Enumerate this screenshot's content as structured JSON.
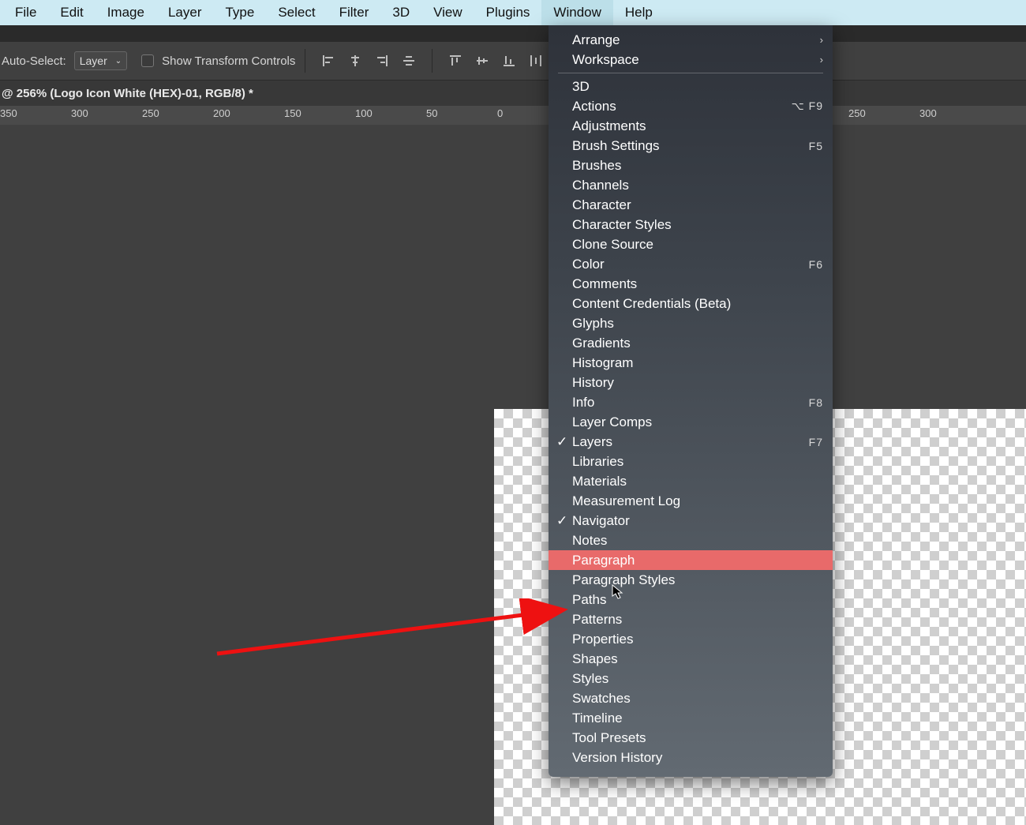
{
  "menubar": {
    "items": [
      "File",
      "Edit",
      "Image",
      "Layer",
      "Type",
      "Select",
      "Filter",
      "3D",
      "View",
      "Plugins",
      "Window",
      "Help"
    ],
    "active": "Window"
  },
  "options": {
    "auto_select_label": "Auto-Select:",
    "auto_select_value": "Layer",
    "show_tc_label": "Show Transform Controls"
  },
  "doc_tab": "@ 256% (Logo Icon White (HEX)-01, RGB/8) *",
  "ruler_ticks": [
    "350",
    "300",
    "250",
    "200",
    "150",
    "100",
    "50",
    "0",
    "",
    "",
    "",
    "",
    "",
    "",
    "250",
    "300"
  ],
  "window_menu": {
    "top": [
      {
        "label": "Arrange",
        "chev": true
      },
      {
        "label": "Workspace",
        "chev": true
      }
    ],
    "items": [
      {
        "label": "3D"
      },
      {
        "label": "Actions",
        "shortcut": "⌥ F9"
      },
      {
        "label": "Adjustments"
      },
      {
        "label": "Brush Settings",
        "shortcut": "F5"
      },
      {
        "label": "Brushes"
      },
      {
        "label": "Channels"
      },
      {
        "label": "Character"
      },
      {
        "label": "Character Styles"
      },
      {
        "label": "Clone Source"
      },
      {
        "label": "Color",
        "shortcut": "F6"
      },
      {
        "label": "Comments"
      },
      {
        "label": "Content Credentials (Beta)"
      },
      {
        "label": "Glyphs"
      },
      {
        "label": "Gradients"
      },
      {
        "label": "Histogram"
      },
      {
        "label": "History"
      },
      {
        "label": "Info",
        "shortcut": "F8"
      },
      {
        "label": "Layer Comps"
      },
      {
        "label": "Layers",
        "shortcut": "F7",
        "checked": true
      },
      {
        "label": "Libraries"
      },
      {
        "label": "Materials"
      },
      {
        "label": "Measurement Log"
      },
      {
        "label": "Navigator",
        "checked": true
      },
      {
        "label": "Notes"
      },
      {
        "label": "Paragraph",
        "hl": true
      },
      {
        "label": "Paragraph Styles"
      },
      {
        "label": "Paths"
      },
      {
        "label": "Patterns"
      },
      {
        "label": "Properties"
      },
      {
        "label": "Shapes"
      },
      {
        "label": "Styles"
      },
      {
        "label": "Swatches"
      },
      {
        "label": "Timeline"
      },
      {
        "label": "Tool Presets"
      },
      {
        "label": "Version History"
      }
    ]
  }
}
